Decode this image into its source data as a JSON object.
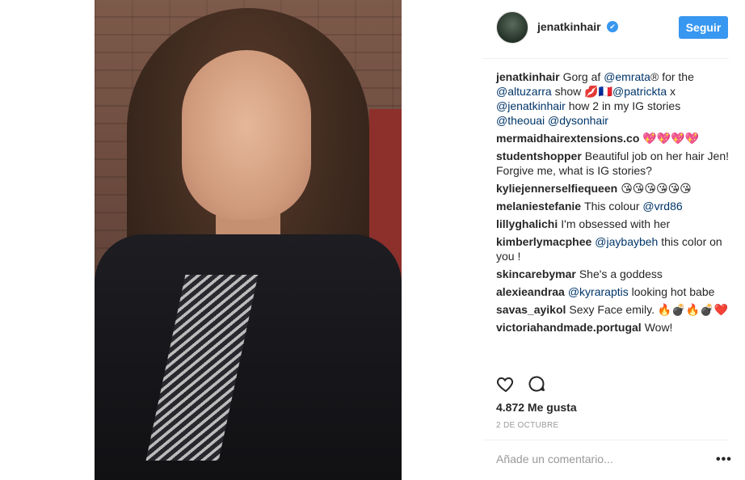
{
  "header": {
    "username": "jenatkinhair",
    "verified_glyph": "✔",
    "follow_label": "Seguir"
  },
  "comments": [
    {
      "user": "jenatkinhair",
      "parts": [
        {
          "t": "Gorg af "
        },
        {
          "m": "@emrata"
        },
        {
          "t": "® for the "
        },
        {
          "m": "@altuzarra"
        },
        {
          "t": " show 💋🇫🇷"
        },
        {
          "m": "@patrickta"
        },
        {
          "t": " x "
        },
        {
          "m": "@jenatkinhair"
        },
        {
          "t": " how 2 in my IG stories "
        },
        {
          "m": "@theouai"
        },
        {
          "t": " "
        },
        {
          "m": "@dysonhair"
        }
      ]
    },
    {
      "user": "mermaidhairextensions.co",
      "parts": [
        {
          "t": "💖💖💖💖"
        }
      ]
    },
    {
      "user": "studentshopper",
      "parts": [
        {
          "t": "Beautiful job on her hair Jen! Forgive me, what is IG stories?"
        }
      ]
    },
    {
      "user": "kyliejennerselfiequeen",
      "parts": [
        {
          "t": "😘😘😘😘😘😘"
        }
      ]
    },
    {
      "user": "melaniestefanie",
      "parts": [
        {
          "t": "This colour "
        },
        {
          "m": "@vrd86"
        }
      ]
    },
    {
      "user": "lillyghalichi",
      "parts": [
        {
          "t": "I'm obsessed with her"
        }
      ]
    },
    {
      "user": "kimberlymacphee",
      "parts": [
        {
          "m": "@jaybaybeh"
        },
        {
          "t": " this color on you !"
        }
      ]
    },
    {
      "user": "skincarebymar",
      "parts": [
        {
          "t": "She's a goddess"
        }
      ]
    },
    {
      "user": "alexieandraa",
      "parts": [
        {
          "m": "@kyraraptis"
        },
        {
          "t": " looking hot babe"
        }
      ]
    },
    {
      "user": "savas_ayikol",
      "parts": [
        {
          "t": "Sexy Face emily. 🔥💣🔥💣❤️"
        }
      ]
    },
    {
      "user": "victoriahandmade.portugal",
      "parts": [
        {
          "t": "Wow!"
        }
      ]
    }
  ],
  "actions": {
    "like_icon": "heart-icon",
    "comment_icon": "comment-icon"
  },
  "likes": "4.872 Me gusta",
  "date": "2 DE OCTUBRE",
  "add_comment_placeholder": "Añade un comentario...",
  "more_icon": "•••",
  "colors": {
    "accent": "#3897f0",
    "mention": "#003569",
    "muted": "#999999"
  }
}
